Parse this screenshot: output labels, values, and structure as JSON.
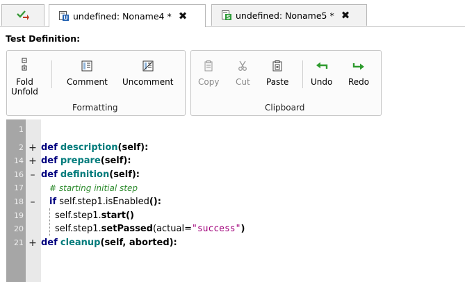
{
  "tabs": [
    {
      "label": "",
      "icon": "check-arrow-icon"
    },
    {
      "label": "undefined: Noname4 *",
      "icon": "test-unit-icon",
      "badge": "U",
      "badge_color": "#1f5fb0",
      "active": true
    },
    {
      "label": "undefined: Noname5 *",
      "icon": "test-suite-icon",
      "badge": "S",
      "badge_color": "#2f9b3a",
      "active": false
    }
  ],
  "section_title": "Test Definition:",
  "ribbon": {
    "formatting": {
      "group_label": "Formatting",
      "fold_line1": "Fold",
      "fold_line2": "Unfold",
      "comment": "Comment",
      "uncomment": "Uncomment"
    },
    "clipboard": {
      "group_label": "Clipboard",
      "copy": "Copy",
      "cut": "Cut",
      "paste": "Paste",
      "undo": "Undo",
      "redo": "Redo"
    }
  },
  "editor": {
    "line_numbers": [
      "1",
      "2",
      "14",
      "16",
      "17",
      "18",
      "19",
      "20",
      "21"
    ],
    "fold_markers": [
      "",
      "+",
      "+",
      "–",
      "",
      "–",
      "",
      "",
      "+"
    ],
    "lines": {
      "l2_kw": "def",
      "l2_fn": "description",
      "l2_rest": "(self):",
      "l14_kw": "def",
      "l14_fn": "prepare",
      "l14_rest": "(self):",
      "l16_kw": "def",
      "l16_fn": "definition",
      "l16_rest": "(self):",
      "l17_comment": "# starting initial step",
      "l18_kw": "if",
      "l18_a": " self.step1.isEnabled",
      "l18_b": "():",
      "l19_a": "self.step1.",
      "l19_b": "start",
      "l19_c": "()",
      "l20_a": "self.step1.",
      "l20_b": "setPassed",
      "l20_c": "(actual=",
      "l20_str": "\"success\"",
      "l20_d": ")",
      "l21_kw": "def",
      "l21_fn": "cleanup",
      "l21_rest": "(self, aborted):"
    }
  },
  "colors": {
    "keyword": "#00007f",
    "function": "#007b7b",
    "comment": "#2e8b2e",
    "string": "#a0007a",
    "gutter": "#a6a6a6",
    "arrow_green": "#2e9b2e"
  }
}
